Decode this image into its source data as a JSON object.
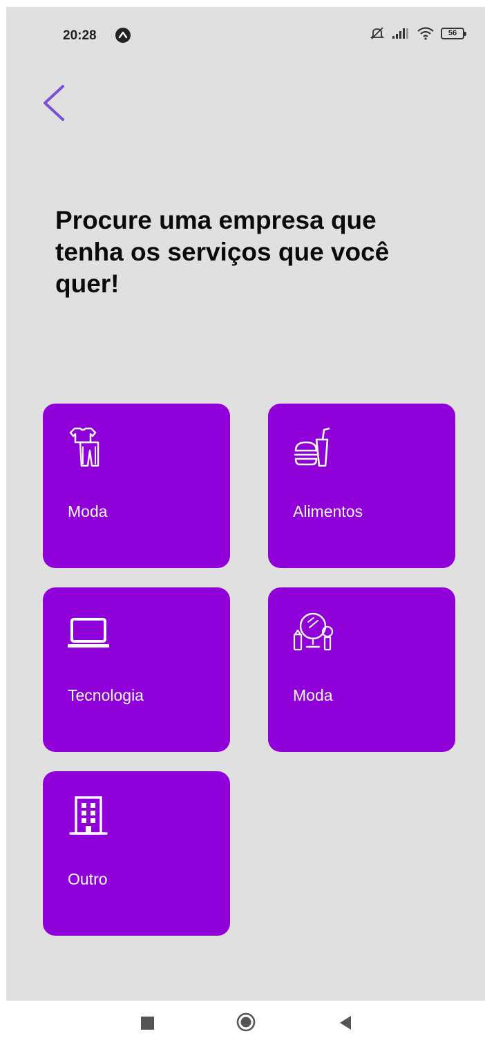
{
  "status_bar": {
    "time": "20:28",
    "battery": "56",
    "icons": [
      "navigation-app-icon",
      "muted-bell-icon",
      "signal-icon",
      "wifi-icon",
      "battery-icon"
    ]
  },
  "header": {
    "back_icon": "chevron-left-icon"
  },
  "title": "Procure uma empresa que tenha os serviços que você quer!",
  "colors": {
    "background": "#e0e0e0",
    "card": "#9000d8",
    "accent": "#7b4fd6",
    "text": "#0a0a0a"
  },
  "categories": [
    {
      "label": "Moda",
      "icon": "clothes-icon"
    },
    {
      "label": "Alimentos",
      "icon": "fast-food-icon"
    },
    {
      "label": "Tecnologia",
      "icon": "laptop-icon"
    },
    {
      "label": "Moda",
      "icon": "makeup-icon"
    },
    {
      "label": "Outro",
      "icon": "building-icon"
    }
  ],
  "nav_bar": {
    "icons": [
      "recents-icon",
      "home-icon",
      "back-icon"
    ]
  }
}
